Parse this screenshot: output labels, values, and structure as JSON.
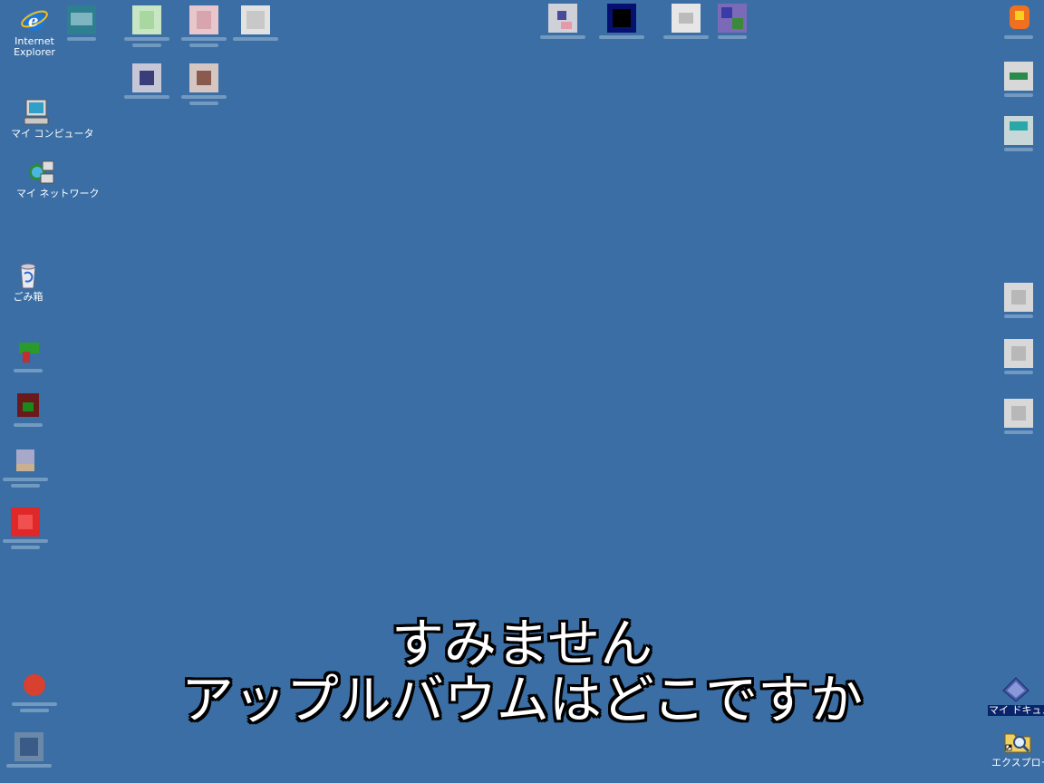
{
  "desktop": {
    "background": "#3a6ea5",
    "icons": {
      "internet_explorer": "Internet\nExplorer",
      "my_computer": "マイ コンピュータ",
      "my_network": "マイ ネットワーク",
      "recycle_bin": "ごみ箱",
      "my_documents": "マイ ドキュメント",
      "explorer": "エクスプローラ"
    }
  },
  "caption": {
    "line1": "すみません",
    "line2": "アップルバウムはどこですか"
  }
}
